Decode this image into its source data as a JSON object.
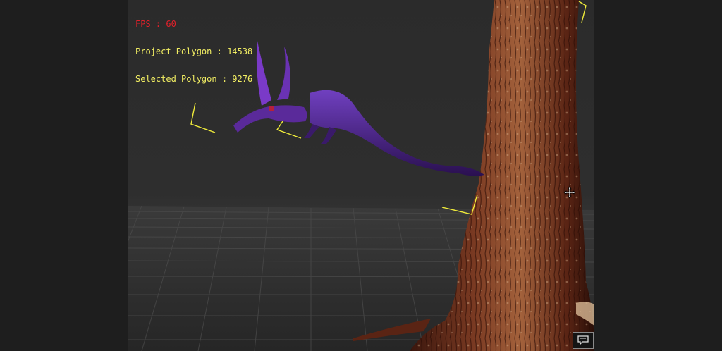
{
  "hud": {
    "fps_label": "FPS",
    "fps_value": "60",
    "project_polygon_label": "Project Polygon",
    "project_polygon_value": "14538",
    "selected_polygon_label": "Selected Polygon",
    "selected_polygon_value": "9276",
    "separator": " : "
  },
  "icons": {
    "move_cursor": "move-cursor-icon",
    "chat": "chat-icon"
  },
  "colors": {
    "fps": "#e0202a",
    "info": "#f2ee63",
    "gizmo": "#f0ec3a",
    "creature": "#5a2aa0",
    "trunk": "#6a2e1c"
  }
}
